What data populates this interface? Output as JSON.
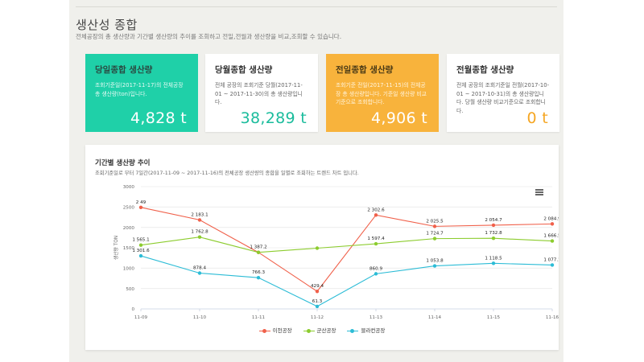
{
  "header": {
    "title": "생산성 종합",
    "description": "전체공장의 총 생산량과 기간별 생산량의 추이를 조회하고 전일,전월과 생산량을 비교,조회할 수 있습니다."
  },
  "cards": [
    {
      "title": "당일종합 생산량",
      "desc": "조회기준일(2017-11-17)의 전체공장 총 생산량(ton)입니다.",
      "value": "4,828 t"
    },
    {
      "title": "당월종합 생산량",
      "desc": "전체 공장의 조회기준 당월(2017-11-01 ~ 2017-11-30)의 총 생산량입니다.",
      "value": "38,289 t"
    },
    {
      "title": "전일종합 생산량",
      "desc": "조회기준 전일(2017-11-15)의 전체공장 총 생산량입니다. 기준일 생산량 비교기준으로 조회합니다.",
      "value": "4,906 t"
    },
    {
      "title": "전월종합 생산량",
      "desc": "전체 공장의 조회기준일 전월(2017-10-01 ~ 2017-10-31)의 총 생산량입니다. 당월 생산량 비교기준으로 조회합니다.",
      "value": "0 t"
    }
  ],
  "trend": {
    "title": "기간별 생산량 추이",
    "description": "조회기준일로 부터 7일간(2017-11-09 ~ 2017-11-16)의 전체공장 생산량의 종합을 일별로 조회하는 트렌드 차트 입니다.",
    "menu_icon": "hamburger-menu-icon"
  },
  "chart_data": {
    "type": "line",
    "categories": [
      "11-09",
      "11-10",
      "11-11",
      "11-12",
      "11-13",
      "11-14",
      "11-15",
      "11-16"
    ],
    "ylabel": "생산량 TON",
    "ylim": [
      0,
      3000
    ],
    "yticks": [
      0,
      500,
      1000,
      1500,
      2000,
      2500,
      3000
    ],
    "legend_position": "bottom",
    "grid": "horizontal",
    "series": [
      {
        "name": "이천공장",
        "color": "#f0604a",
        "values": [
          2490,
          2183.1,
          1387.2,
          429.4,
          2302.6,
          2025.5,
          2054.7,
          2084.9
        ],
        "labels": [
          "2 49",
          "2 183.1",
          "",
          "429.4",
          "2 302.6",
          "2 025.5",
          "2 054.7",
          "2 084.9"
        ]
      },
      {
        "name": "군산공장",
        "color": "#8ccc2e",
        "values": [
          1565.1,
          1762.8,
          1387.2,
          1490,
          1597.4,
          1724.7,
          1732.8,
          1666.5
        ],
        "labels": [
          "1 565.1",
          "1 762.8",
          "1 387.2",
          "",
          "1 597.4",
          "1 724.7",
          "1 732.8",
          "1 666.5"
        ]
      },
      {
        "name": "블라컨공장",
        "color": "#2cbcd6",
        "values": [
          1301.6,
          878.4,
          766.3,
          61.3,
          860.9,
          1053.8,
          1118.5,
          1077.1
        ],
        "labels": [
          "1 301.6",
          "878.4",
          "766.3",
          "61.3",
          "860.9",
          "1 053.8",
          "1 118.5",
          "1 077.1"
        ]
      }
    ]
  }
}
